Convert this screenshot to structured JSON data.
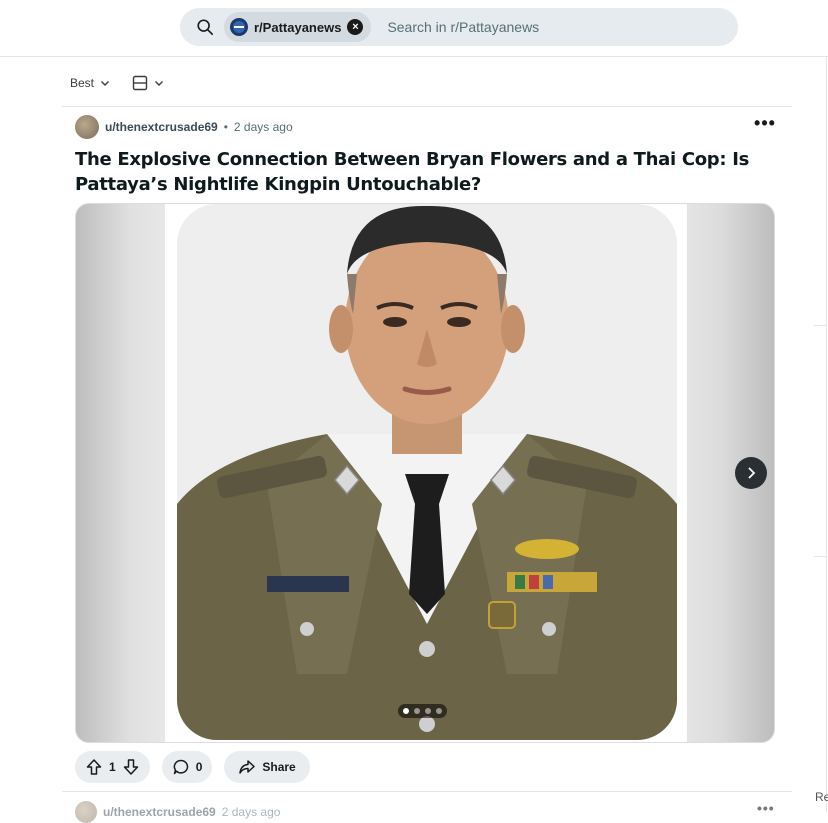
{
  "search": {
    "community_chip": "r/Pattayanews",
    "placeholder": "Search in r/Pattayanews",
    "chip_close": "×"
  },
  "sort": {
    "label": "Best"
  },
  "post": {
    "username": "u/thenextcrusade69",
    "separator": "•",
    "time": "2 days ago",
    "more": "•••",
    "title": "The Explosive Connection Between Bryan Flowers and a Thai Cop: Is Pattaya’s Nightlife Kingpin Untouchable?",
    "image_subject": "Portrait of a Thai police officer in olive uniform with insignia",
    "carousel": {
      "total": 4,
      "active_index": 0
    },
    "vote_count": "1",
    "comment_count": "0",
    "share_label": "Share"
  },
  "next_post": {
    "username": "u/thenextcrusade69",
    "time": "2 days ago",
    "more": "•••"
  },
  "sidebar_cutoff_text": "Re",
  "colors": {
    "search_bg": "#e5ebee",
    "pill_bg": "#eaedef",
    "uniform": "#6b6447",
    "next_button": "#2a2f33"
  }
}
